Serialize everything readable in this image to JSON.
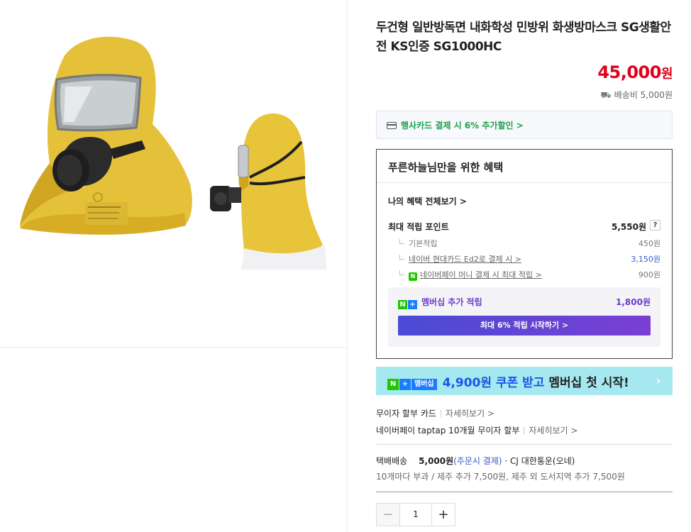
{
  "product": {
    "title": "두건형 일반방독면 내화학성 민방위 화생방마스크 SG생활안전 KS인증 SG1000HC",
    "price": "45,000",
    "price_unit": "원",
    "shipping_fee": "배송비 5,000원"
  },
  "card_promo": {
    "text": "행사카드 결제 시 6% 추가할인 >"
  },
  "benefits": {
    "header": "푸른하늘님만을 위한 혜택",
    "view_all": "나의 혜택 전체보기 >",
    "max_points_label": "최대 적립 포인트",
    "max_points_value": "5,550원",
    "help": "?",
    "items": [
      {
        "label": "기본적립",
        "value": "450원"
      },
      {
        "label": "네이버 현대카드 Ed2로 결제 시 >",
        "value": "3,150원"
      },
      {
        "label": "네이버페이 머니 결제 시 최대 적립 >",
        "value": "900원",
        "badge": "N"
      }
    ],
    "membership_label": "멤버십 추가 적립",
    "membership_value": "1,800원",
    "start_button": "최대 6% 적립 시작하기 >"
  },
  "coupon_banner": {
    "badge_n": "N",
    "badge_plus": "+",
    "badge_text": "멤버십",
    "text_highlight": "4,900원 쿠폰 받고",
    "text_rest": "멤버십 첫 시작!",
    "arrow": "›"
  },
  "installments": [
    {
      "label": "무이자 할부 카드",
      "more": "자세히보기 >"
    },
    {
      "label": "네이버페이 taptap 10개월 무이자 할부",
      "more": "자세히보기 >"
    }
  ],
  "delivery": {
    "label": "택배배송",
    "fee": "5,000원",
    "condition": "(주문시 결제)",
    "carrier": "· CJ 대한통운(오네)",
    "note": "10개마다 부과 / 제주 추가 7,500원, 제주 외 도서지역 추가 7,500원"
  },
  "quantity": {
    "minus": "−",
    "value": "1",
    "plus": "+"
  },
  "colors": {
    "price": "#e1001b",
    "promo_green": "#1a9e4b",
    "membership_purple": "#6a3ccc",
    "banner_bg": "#a6e8ef",
    "mask_yellow": "#e8c43a"
  }
}
